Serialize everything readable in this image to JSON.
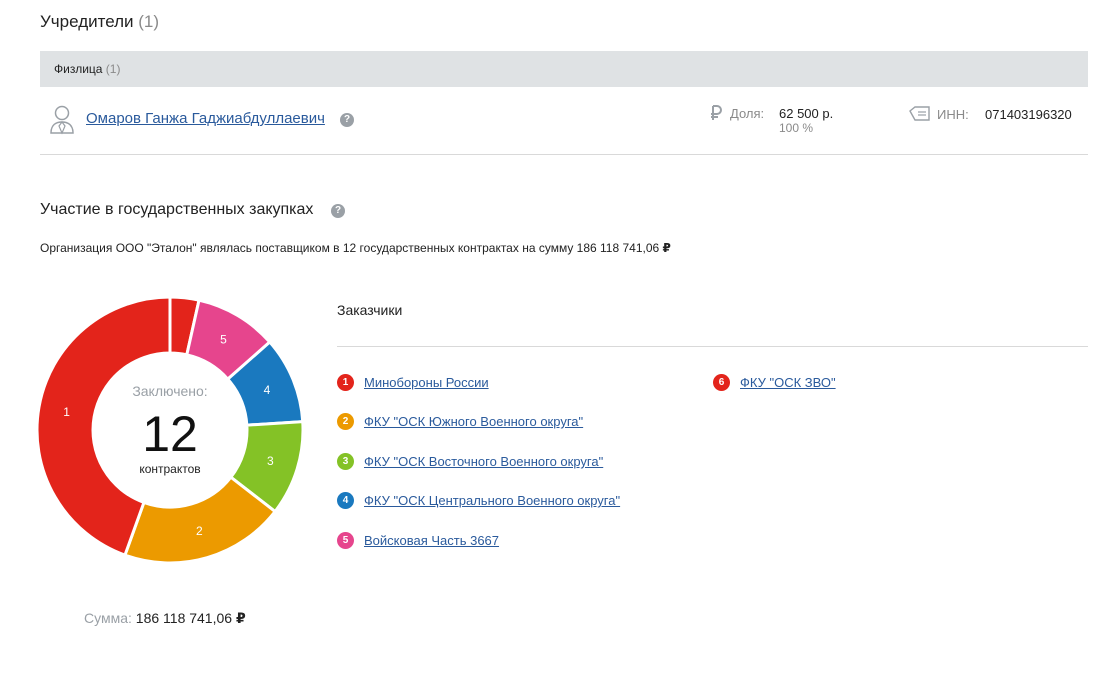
{
  "founders": {
    "title": "Учредители",
    "count": "(1)",
    "group_label": "Физлица",
    "group_count": "(1)",
    "person": {
      "name": "Омаров Ганжа Гаджиабдуллаевич",
      "share_icon": "ruble-icon",
      "share_label": "Доля:",
      "share_value": "62 500 р.",
      "share_percent": "100 %",
      "inn_icon": "id-card-icon",
      "inn_label": "ИНН:",
      "inn_value": "071403196320"
    }
  },
  "procurement": {
    "title": "Участие в государственных закупках",
    "summary_prefix": "Организация ООО \"Эталон\" являлась поставщиком в 12 государственных контрактах на сумму 186 118 741,06",
    "currency": "₽",
    "donut_caption": "Заключено:",
    "donut_total": "12",
    "donut_unit": "контрактов",
    "sum_label": "Сумма:",
    "sum_value": "186 118 741,06",
    "customers_title": "Заказчики",
    "customers": [
      {
        "num": "1",
        "name": "Минобороны России",
        "color": "#e3241b"
      },
      {
        "num": "2",
        "name": "ФКУ \"ОСК Южного Военного округа\"",
        "color": "#ec9a00"
      },
      {
        "num": "3",
        "name": "ФКУ \"ОСК Восточного Военного округа\"",
        "color": "#84c226"
      },
      {
        "num": "4",
        "name": "ФКУ \"ОСК Центрального Военного округа\"",
        "color": "#1a79bf"
      },
      {
        "num": "5",
        "name": "Войсковая Часть 3667",
        "color": "#e6458d"
      },
      {
        "num": "6",
        "name": "ФКУ \"ОСК ЗВО\"",
        "color": "#e3241b"
      }
    ]
  },
  "chart_data": {
    "type": "pie",
    "categories": [
      "6",
      "5",
      "4",
      "3",
      "2",
      "1"
    ],
    "values": [
      0.035,
      0.1,
      0.105,
      0.115,
      0.2,
      0.445
    ],
    "colors": [
      "#e3241b",
      "#e6458d",
      "#1a79bf",
      "#84c226",
      "#ec9a00",
      "#e3241b"
    ],
    "title": "",
    "labels_shown": [
      "",
      "5",
      "4",
      "3",
      "2",
      "1"
    ]
  }
}
